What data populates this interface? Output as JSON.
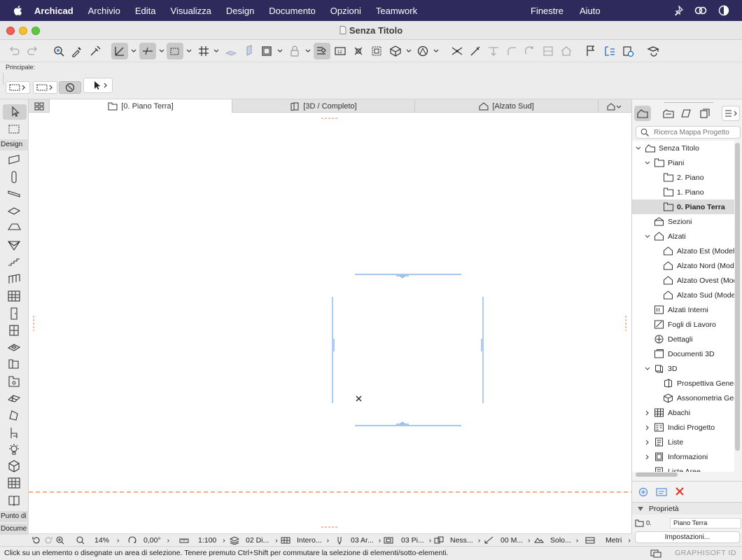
{
  "menubar": {
    "app_name": "Archicad",
    "items": [
      "Archivio",
      "Edita",
      "Visualizza",
      "Design",
      "Documento",
      "Opzioni",
      "Teamwork"
    ],
    "right_items": [
      "Finestre",
      "Aiuto"
    ]
  },
  "window": {
    "title": "Senza Titolo"
  },
  "infobox": {
    "label": "Principale:"
  },
  "toolbox": {
    "header_design": "Design",
    "footer_1": "Punto di",
    "footer_2": "Docume"
  },
  "tabs": [
    {
      "label": "[0. Piano Terra]"
    },
    {
      "label": "[3D / Completo]"
    },
    {
      "label": "[Alzato Sud]"
    }
  ],
  "navigator": {
    "search_placeholder": "Ricerca Mappa Progetto",
    "tree": [
      {
        "label": "Senza Titolo"
      },
      {
        "label": "Piani"
      },
      {
        "label": "2. Piano"
      },
      {
        "label": "1. Piano"
      },
      {
        "label": "0. Piano Terra"
      },
      {
        "label": "Sezioni"
      },
      {
        "label": "Alzati"
      },
      {
        "label": "Alzato Est (Modello"
      },
      {
        "label": "Alzato Nord (Mode"
      },
      {
        "label": "Alzato Ovest (Mod"
      },
      {
        "label": "Alzato Sud (Model"
      },
      {
        "label": "Alzati Interni"
      },
      {
        "label": "Fogli di Lavoro"
      },
      {
        "label": "Dettagli"
      },
      {
        "label": "Documenti 3D"
      },
      {
        "label": "3D"
      },
      {
        "label": "Prospettiva Generi"
      },
      {
        "label": "Assonometria Gen"
      },
      {
        "label": "Abachi"
      },
      {
        "label": "Indici Progetto"
      },
      {
        "label": "Liste"
      },
      {
        "label": "Informazioni"
      },
      {
        "label": "Liste Aree"
      }
    ],
    "properties_label": "Proprietà",
    "prop_id": "0.",
    "prop_value": "Piano Terra",
    "settings_button": "Impostazioni..."
  },
  "quickbar": {
    "zoom": "14%",
    "angle": "0,00°",
    "scale": "1:100",
    "layers": "02 Di...",
    "model_view": "Intero...",
    "pen_set": "03 Ar...",
    "view_filter": "03 Pi...",
    "renovation": "Ness...",
    "dimension": "00 M...",
    "graphic_override": "Solo...",
    "units": "Metri"
  },
  "status": {
    "message": "Click su un elemento o disegnate un area di selezione. Tenere premuto Ctrl+Shift per commutare la selezione di elementi/sotto-elementi.",
    "brand": "GRAPHISOFT ID"
  },
  "colors": {
    "menubar_bg": "#2e2a5c",
    "accent_blue": "#4d8fe0",
    "marker_orange": "#f07a3c",
    "delete_red": "#e0322b"
  }
}
